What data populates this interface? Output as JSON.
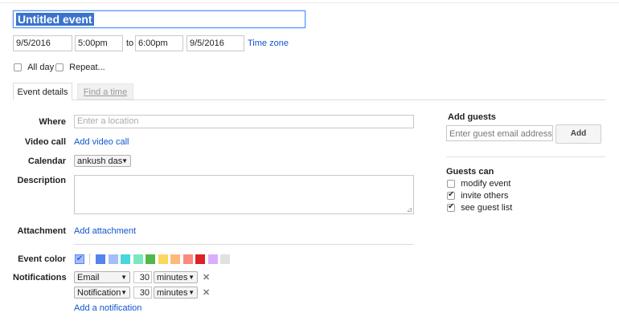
{
  "event": {
    "title": "Untitled event",
    "start_date": "9/5/2016",
    "start_time": "5:00pm",
    "to_label": "to",
    "end_time": "6:00pm",
    "end_date": "9/5/2016",
    "timezone_link": "Time zone",
    "all_day_label": "All day",
    "all_day_checked": false,
    "repeat_label": "Repeat...",
    "repeat_checked": false
  },
  "tabs": [
    {
      "label": "Event details",
      "active": true
    },
    {
      "label": "Find a time",
      "active": false
    }
  ],
  "details": {
    "where_label": "Where",
    "where_placeholder": "Enter a location",
    "video_label": "Video call",
    "video_link": "Add video call",
    "calendar_label": "Calendar",
    "calendar_value": "ankush das",
    "description_label": "Description",
    "attachment_label": "Attachment",
    "attachment_link": "Add attachment",
    "color_label": "Event color",
    "colors": [
      "#a4bdfc",
      "#5484ed",
      "#a4bdfc",
      "#46d6db",
      "#7ae7bf",
      "#51b749",
      "#fbd75b",
      "#ffb878",
      "#ff887c",
      "#dc2127",
      "#dbadff",
      "#e1e1e1"
    ],
    "notifications_label": "Notifications",
    "notifications": [
      {
        "type": "Email",
        "amount": "30",
        "unit": "minutes"
      },
      {
        "type": "Notification",
        "amount": "30",
        "unit": "minutes"
      }
    ],
    "add_notification_link": "Add a notification"
  },
  "guests": {
    "heading": "Add guests",
    "input_placeholder": "Enter guest email addresses",
    "add_button": "Add",
    "can_heading": "Guests can",
    "permissions": [
      {
        "label": "modify event",
        "checked": false
      },
      {
        "label": "invite others",
        "checked": true
      },
      {
        "label": "see guest list",
        "checked": true
      }
    ]
  }
}
